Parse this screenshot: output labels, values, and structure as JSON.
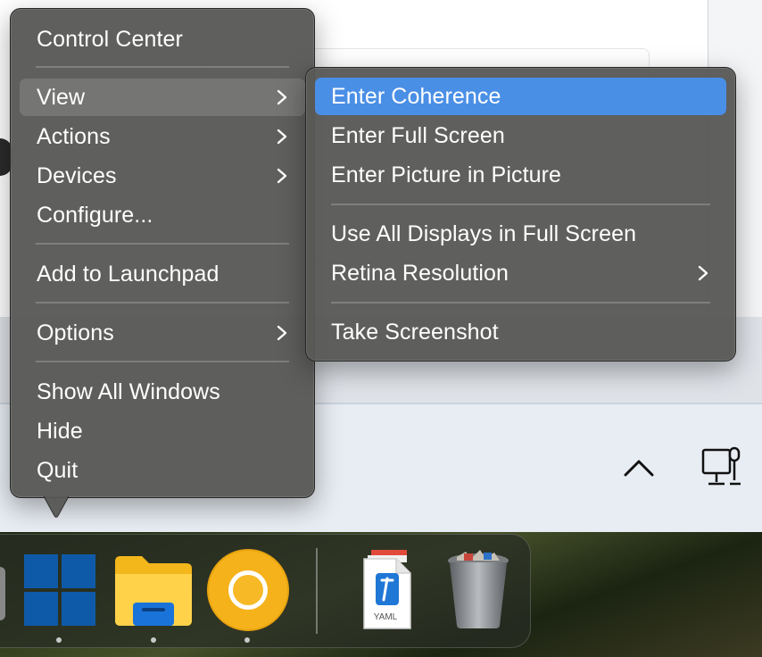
{
  "main_menu": {
    "items": [
      {
        "label": "Control Center"
      },
      {
        "label": "View"
      },
      {
        "label": "Actions"
      },
      {
        "label": "Devices"
      },
      {
        "label": "Configure..."
      },
      {
        "label": "Add to Launchpad"
      },
      {
        "label": "Options"
      },
      {
        "label": "Show All Windows"
      },
      {
        "label": "Hide"
      },
      {
        "label": "Quit"
      }
    ]
  },
  "view_submenu": {
    "items": [
      {
        "label": "Enter Coherence"
      },
      {
        "label": "Enter Full Screen"
      },
      {
        "label": "Enter Picture in Picture"
      },
      {
        "label": "Use All Displays in Full Screen"
      },
      {
        "label": "Retina Resolution"
      },
      {
        "label": "Take Screenshot"
      }
    ]
  },
  "dock": {
    "yaml_label": "YAML",
    "icons": [
      "windows-start-icon",
      "file-explorer-icon",
      "chrome-canary-icon",
      "yaml-document-icon",
      "trash-icon"
    ]
  },
  "tray": {
    "icons": [
      "chevron-up-icon",
      "network-monitor-icon"
    ]
  },
  "colors": {
    "menu_bg": "#585856",
    "menu_highlight": "#4a8fe6",
    "menu_text": "#ffffff"
  }
}
